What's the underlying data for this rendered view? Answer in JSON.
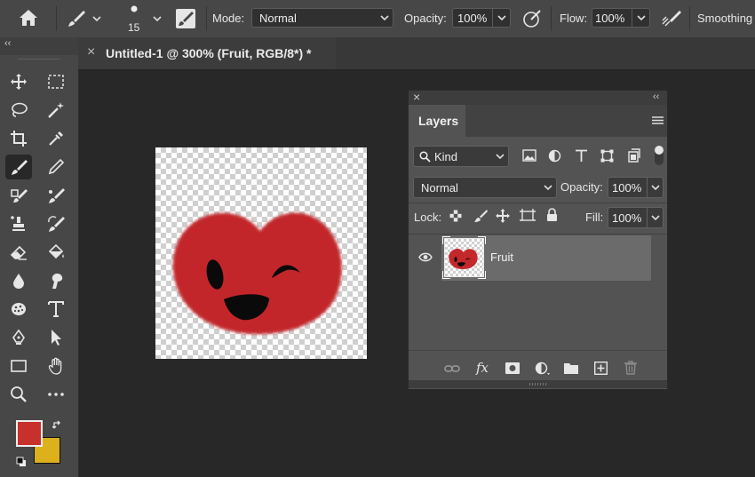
{
  "options_bar": {
    "brush_size": "15",
    "mode_label": "Mode:",
    "mode_value": "Normal",
    "opacity_label": "Opacity:",
    "opacity_value": "100%",
    "flow_label": "Flow:",
    "flow_value": "100%",
    "smoothing_label": "Smoothing"
  },
  "document_tab": {
    "close_glyph": "×",
    "title": "Untitled-1 @ 300% (Fruit, RGB/8*) *"
  },
  "toolbar": {
    "collapse_glyph": "‹‹",
    "tools": [
      "move-tool",
      "artboard-tool",
      "lasso-tool",
      "magic-wand-tool",
      "crop-tool",
      "eyedropper-tool",
      "brush-tool",
      "pencil-tool",
      "clone-brush-tool",
      "mixer-brush-tool",
      "clone-stamp-tool",
      "history-brush-tool",
      "eraser-tool",
      "paint-bucket-tool",
      "blur-tool",
      "smudge-tool",
      "sponge-tool",
      "type-tool",
      "pen-tool",
      "path-selection-tool",
      "rectangle-tool",
      "hand-tool",
      "zoom-tool",
      "more-tools"
    ],
    "active_tool": "brush-tool",
    "foreground_color": "#c8302b",
    "background_color": "#dcb11c"
  },
  "layers_panel": {
    "tab_label": "Layers",
    "close_glyph": "×",
    "collapse_glyph": "‹‹",
    "filter_value": "Kind",
    "blend_mode": "Normal",
    "opacity_label": "Opacity:",
    "opacity_value": "100%",
    "lock_label": "Lock:",
    "fill_label": "Fill:",
    "fill_value": "100%",
    "layers": [
      {
        "name": "Fruit",
        "visible": true,
        "selected": true
      }
    ]
  },
  "colors": {
    "fruit_red": "#c3282a",
    "ui_dark": "#282828",
    "panel": "#535353"
  }
}
